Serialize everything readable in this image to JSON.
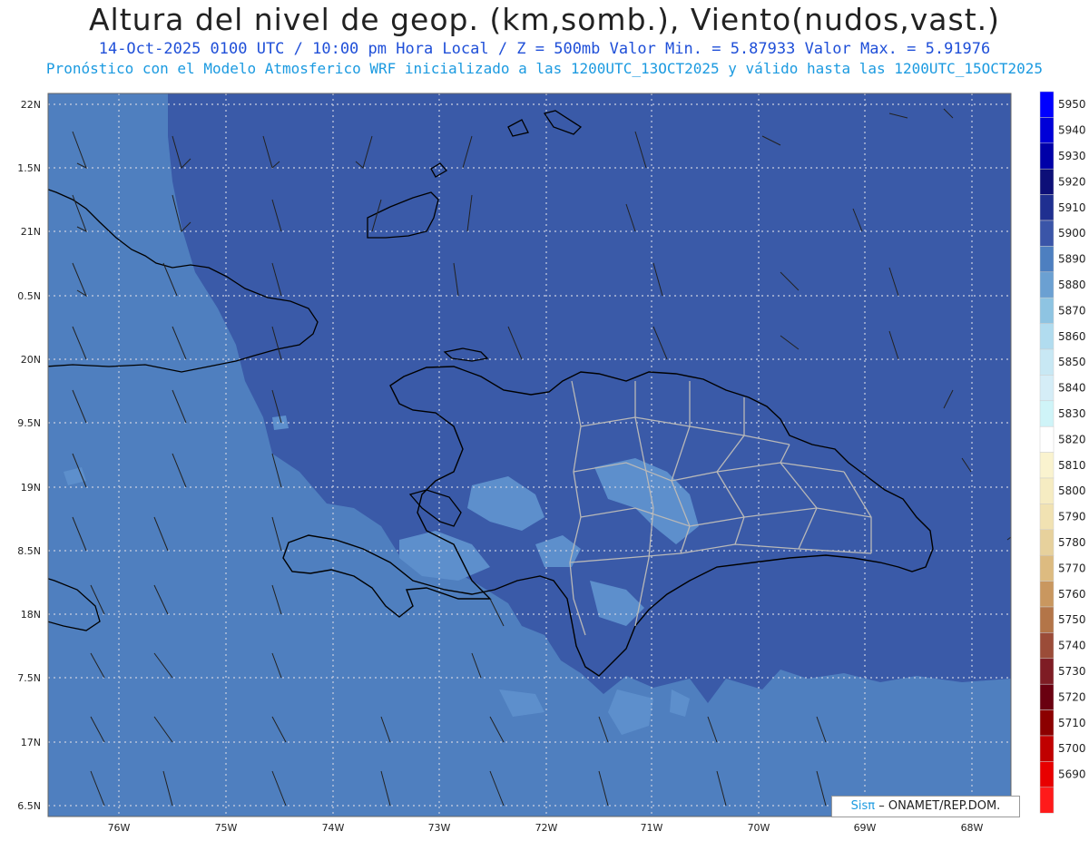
{
  "header": {
    "title": "Altura del nivel de geop. (km,somb.), Viento(nudos,vast.)",
    "subtitle": "14-Oct-2025  0100 UTC / 10:00 pm Hora Local / Z = 500mb    Valor Min. = 5.87933  Valor Max. = 5.91976",
    "info": "Pronóstico con el Modelo Atmosferico WRF inicializado a las 1200UTC_13OCT2025 y válido hasta las  1200UTC_15OCT2025"
  },
  "map": {
    "lat_labels": [
      "22N",
      "1.5N",
      "21N",
      "0.5N",
      "20N",
      "9.5N",
      "19N",
      "8.5N",
      "18N",
      "7.5N",
      "17N",
      "6.5N"
    ],
    "lon_labels": [
      "76W",
      "75W",
      "74W",
      "73W",
      "72W",
      "71W",
      "70W",
      "69W",
      "68W"
    ],
    "colors": {
      "ocean_light": "#4f7fbf",
      "land_dark": "#3a5aa8",
      "mid": "#5d8fcc",
      "coast": "#000000",
      "provinces": "#b8b8b8",
      "grid": "#c9cfe0"
    }
  },
  "colorbar": {
    "levels": [
      {
        "label": "5950",
        "color": "#0000ff"
      },
      {
        "label": "5940",
        "color": "#0000d8"
      },
      {
        "label": "5930",
        "color": "#0000a8"
      },
      {
        "label": "5920",
        "color": "#0d0f78"
      },
      {
        "label": "5910",
        "color": "#1f2f90"
      },
      {
        "label": "5900",
        "color": "#3a55a8"
      },
      {
        "label": "5890",
        "color": "#4d7fc0"
      },
      {
        "label": "5880",
        "color": "#6ba0d2"
      },
      {
        "label": "5870",
        "color": "#8ec4e2"
      },
      {
        "label": "5860",
        "color": "#b1dcef"
      },
      {
        "label": "5850",
        "color": "#c8e8f4"
      },
      {
        "label": "5840",
        "color": "#d5edf7"
      },
      {
        "label": "5830",
        "color": "#cff4f8"
      },
      {
        "label": "5820",
        "color": "#ffffff"
      },
      {
        "label": "5810",
        "color": "#faf3cf"
      },
      {
        "label": "5800",
        "color": "#f6ecc2"
      },
      {
        "label": "5790",
        "color": "#f1e2b2"
      },
      {
        "label": "5780",
        "color": "#e7d19c"
      },
      {
        "label": "5770",
        "color": "#ddbb80"
      },
      {
        "label": "5760",
        "color": "#c9975f"
      },
      {
        "label": "5750",
        "color": "#b37548"
      },
      {
        "label": "5740",
        "color": "#9b4c38"
      },
      {
        "label": "5730",
        "color": "#7e1c24"
      },
      {
        "label": "5720",
        "color": "#6a0010"
      },
      {
        "label": "5710",
        "color": "#8c0000"
      },
      {
        "label": "5700",
        "color": "#c00000"
      },
      {
        "label": "5690",
        "color": "#e80000"
      },
      {
        "label": "",
        "color": "#ff1a1a"
      }
    ]
  },
  "credit": {
    "brand": "Sisπ",
    "text": "– ONAMET/REP.DOM."
  }
}
